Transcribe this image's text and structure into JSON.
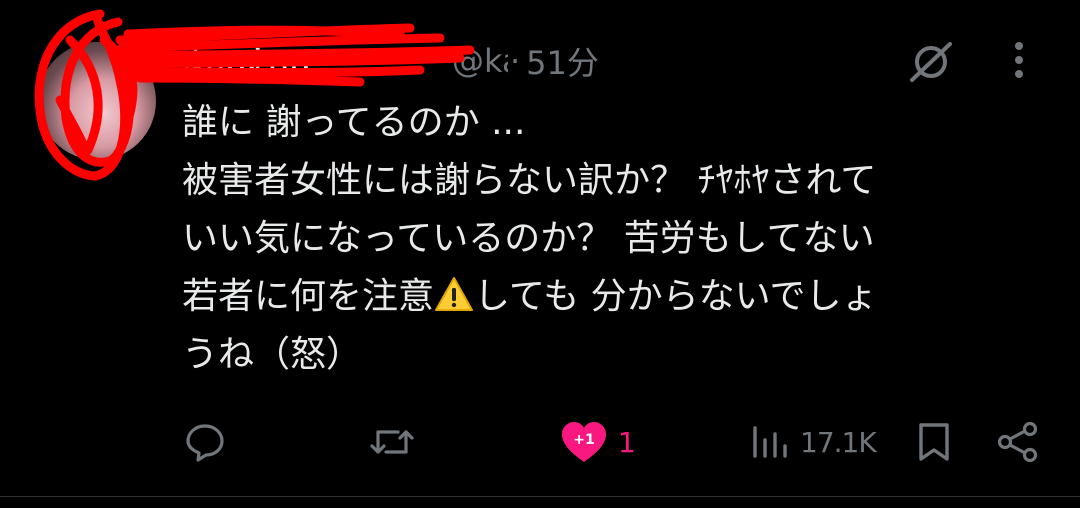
{
  "tweet": {
    "display_name": "あいおい",
    "handle": "@kai",
    "separator": "·",
    "time": "51分",
    "lines": [
      "誰に 謝ってるのか ...",
      "被害者女性には謝らない訳か？ ﾁﾔﾎﾔされて",
      "いい気になっているのか？ 苦労もしてない",
      "若者に何を注意",
      "しても 分からないでしょ",
      "うね（怒）"
    ],
    "line4_after": "しても 分からないでしょ",
    "emoji": "warning-emoji"
  },
  "actions": {
    "like_count": "1",
    "like_badge": "+1",
    "views_count": "17.1K",
    "like_color": "#f91880",
    "muted_color": "#71767b"
  }
}
